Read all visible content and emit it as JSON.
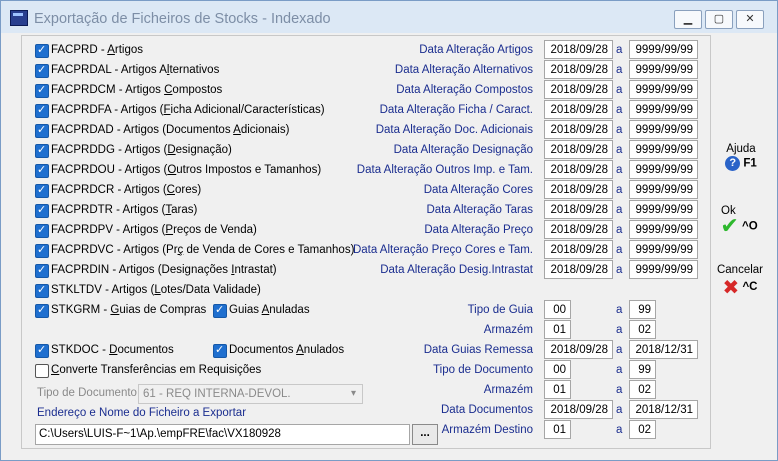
{
  "window": {
    "title": "Exportação de Ficheiros de Stocks - Indexado"
  },
  "rows": [
    {
      "pre": "FACPRD - ",
      "u": "A",
      "post": "rtigos",
      "date_label": "Data Alteração Artigos",
      "from": "2018/09/28",
      "to": "9999/99/99"
    },
    {
      "pre": "FACPRDAL - Artigos A",
      "u": "l",
      "post": "ternativos",
      "date_label": "Data Alteração Alternativos",
      "from": "2018/09/28",
      "to": "9999/99/99"
    },
    {
      "pre": "FACPRDCM - Artigos ",
      "u": "C",
      "post": "ompostos",
      "date_label": "Data Alteração Compostos",
      "from": "2018/09/28",
      "to": "9999/99/99"
    },
    {
      "pre": "FACPRDFA - Artigos (",
      "u": "F",
      "post": "icha Adicional/Características)",
      "date_label": "Data Alteração Ficha / Caract.",
      "from": "2018/09/28",
      "to": "9999/99/99"
    },
    {
      "pre": "FACPRDAD - Artigos (Documentos ",
      "u": "A",
      "post": "dicionais)",
      "date_label": "Data Alteração Doc. Adicionais",
      "from": "2018/09/28",
      "to": "9999/99/99"
    },
    {
      "pre": "FACPRDDG - Artigos (",
      "u": "D",
      "post": "esignação)",
      "date_label": "Data Alteração Designação",
      "from": "2018/09/28",
      "to": "9999/99/99"
    },
    {
      "pre": "FACPRDOU - Artigos (",
      "u": "O",
      "post": "utros Impostos e Tamanhos)",
      "date_label": "Data Alteração Outros Imp. e Tam.",
      "from": "2018/09/28",
      "to": "9999/99/99"
    },
    {
      "pre": "FACPRDCR - Artigos (",
      "u": "C",
      "post": "ores)",
      "date_label": "Data Alteração Cores",
      "from": "2018/09/28",
      "to": "9999/99/99"
    },
    {
      "pre": "FACPRDTR - Artigos (",
      "u": "T",
      "post": "aras)",
      "date_label": "Data Alteração Taras",
      "from": "2018/09/28",
      "to": "9999/99/99"
    },
    {
      "pre": "FACPRDPV - Artigos (",
      "u": "P",
      "post": "reços de Venda)",
      "date_label": "Data Alteração Preço",
      "from": "2018/09/28",
      "to": "9999/99/99"
    },
    {
      "pre": "FACPRDVC - Artigos (Pr",
      "u": "ç",
      "post": " de Venda de Cores e Tamanhos)",
      "date_label": "Data Alteração Preço Cores e Tam.",
      "from": "2018/09/28",
      "to": "9999/99/99"
    },
    {
      "pre": "FACPRDIN - Artigos (Designações ",
      "u": "I",
      "post": "ntrastat)",
      "date_label": "Data Alteração Desig.Intrastat",
      "from": "2018/09/28",
      "to": "9999/99/99"
    }
  ],
  "a_label": "a",
  "stkltdv": {
    "pre": "STKLTDV - Artigos (",
    "u": "L",
    "post": "otes/Data Validade)"
  },
  "stkgrm": {
    "pre": "STKGRM - ",
    "u": "G",
    "post": "uias de Compras"
  },
  "guias_anuladas": {
    "pre": "Guias ",
    "u": "A",
    "post": "nuladas"
  },
  "tipo_guia": {
    "label": "Tipo de Guia",
    "from": "00",
    "to": "99"
  },
  "armazem1": {
    "label": "Armazém",
    "from": "01",
    "to": "02"
  },
  "stkdoc": {
    "pre": "STKDOC - ",
    "u": "D",
    "post": "ocumentos"
  },
  "doc_anulados": {
    "pre": "Documentos ",
    "u": "A",
    "post": "nulados"
  },
  "data_guias": {
    "label": "Data Guias Remessa",
    "from": "2018/09/28",
    "to": "2018/12/31"
  },
  "converte": {
    "pre": "",
    "u": "C",
    "post": "onverte Transferências em Requisições"
  },
  "tipo_doc_r": {
    "label": "Tipo de Documento",
    "from": "00",
    "to": "99"
  },
  "tipo_doc_sel": {
    "label": "Tipo de Documento",
    "value": "61 - REQ INTERNA-DEVOL."
  },
  "armazem2": {
    "label": "Armazém",
    "from": "01",
    "to": "02"
  },
  "path_label": "Endereço e Nome do Ficheiro a Exportar",
  "data_docs": {
    "label": "Data Documentos",
    "from": "2018/09/28",
    "to": "2018/12/31"
  },
  "path_value": "C:\\Users\\LUIS-F~1\\Ap.\\empFRE\\fac\\VX180928",
  "browse_label": "...",
  "armazem_dest": {
    "label": "Armazém Destino",
    "from": "01",
    "to": "02"
  },
  "side": {
    "help": {
      "label": "Ajuda",
      "key": "F1",
      "icon": "help-icon"
    },
    "ok": {
      "label": "Ok",
      "key": "^O",
      "icon": "check-icon"
    },
    "cancel": {
      "label": "Cancelar",
      "key": "^C",
      "icon": "cross-icon"
    }
  },
  "colors": {
    "accent": "#1f6fcf",
    "label_blue": "#1a2d8f",
    "ok_green": "#2eb82e",
    "cancel_red": "#d62828"
  }
}
